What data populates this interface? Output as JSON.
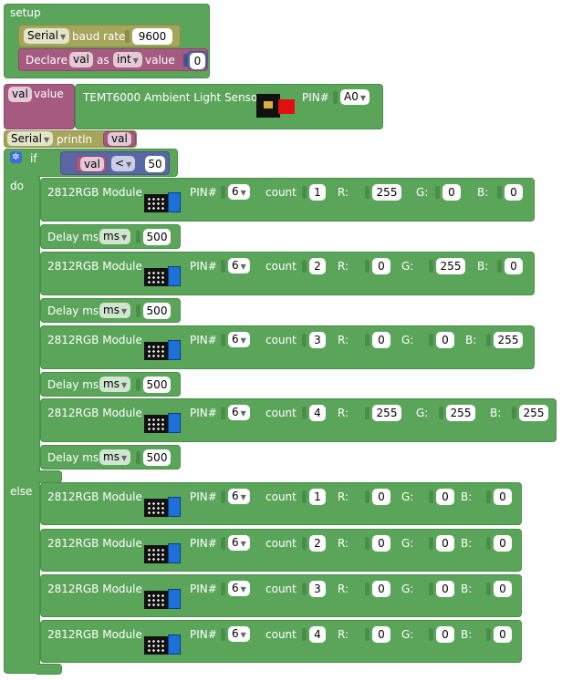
{
  "setup": {
    "label": "setup",
    "serial": "Serial",
    "baud_label": "baud rate",
    "baud": "9600",
    "declare_label": "Declare",
    "var": "val",
    "as_label": "as",
    "type": "int",
    "value_label": "value",
    "init_value": "0"
  },
  "assign": {
    "var": "val",
    "value_label": "value",
    "sensor_label": "TEMT6000 Ambient Light Sensor",
    "pin_label": "PIN#",
    "pin": "A0"
  },
  "println": {
    "serial": "Serial",
    "label": "println",
    "var": "val"
  },
  "if_block": {
    "if_label": "if",
    "var": "val",
    "op": "<",
    "compare": "50",
    "do_label": "do",
    "else_label": "else"
  },
  "labels": {
    "module": "2812RGB Module",
    "pin": "PIN#",
    "count": "count",
    "r": "R:",
    "g": "G:",
    "b": "B:",
    "delay": "Delay ms",
    "ms": "ms"
  },
  "do_rows": [
    {
      "pin": "6",
      "count": "1",
      "r": "255",
      "g": "0",
      "b": "0",
      "delay": "500"
    },
    {
      "pin": "6",
      "count": "2",
      "r": "0",
      "g": "255",
      "b": "0",
      "delay": "500"
    },
    {
      "pin": "6",
      "count": "3",
      "r": "0",
      "g": "0",
      "b": "255",
      "delay": "500"
    },
    {
      "pin": "6",
      "count": "4",
      "r": "255",
      "g": "255",
      "b": "255",
      "delay": "500"
    }
  ],
  "else_rows": [
    {
      "pin": "6",
      "count": "1",
      "r": "0",
      "g": "0",
      "b": "0"
    },
    {
      "pin": "6",
      "count": "2",
      "r": "0",
      "g": "0",
      "b": "0"
    },
    {
      "pin": "6",
      "count": "3",
      "r": "0",
      "g": "0",
      "b": "0"
    },
    {
      "pin": "6",
      "count": "4",
      "r": "0",
      "g": "0",
      "b": "0"
    }
  ],
  "colors": {
    "control": "#5ba55b",
    "serial": "#a5a55b",
    "variable": "#a55b80",
    "logic": "#5b67a5"
  }
}
